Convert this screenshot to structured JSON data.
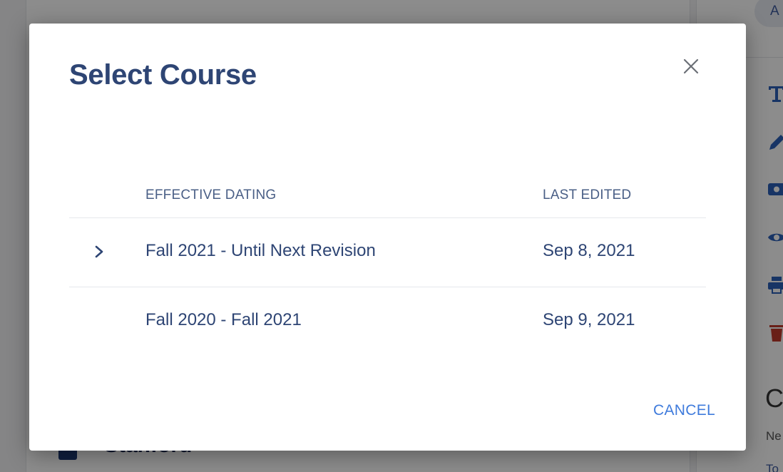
{
  "background": {
    "top_pill_label": "A",
    "right_heading": "C",
    "right_meta_1": "Ne",
    "right_meta_2": "To",
    "institution_name": "Stanford",
    "icons": [
      "text-format-icon",
      "pencil-icon",
      "camera-icon",
      "eye-icon",
      "printer-icon",
      "trash-icon"
    ]
  },
  "modal": {
    "title": "Select Course",
    "columns": {
      "effective_dating": "EFFECTIVE DATING",
      "last_edited": "LAST EDITED"
    },
    "rows": [
      {
        "effective_dating": "Fall 2021 - Until Next Revision",
        "last_edited": "Sep 8, 2021",
        "has_chevron": true
      },
      {
        "effective_dating": "Fall 2020 - Fall 2021",
        "last_edited": "Sep 9, 2021",
        "has_chevron": false
      }
    ],
    "cancel_label": "CANCEL"
  },
  "colors": {
    "title": "#2e4574",
    "accent": "#3f7bdc",
    "danger": "#c0392b"
  }
}
